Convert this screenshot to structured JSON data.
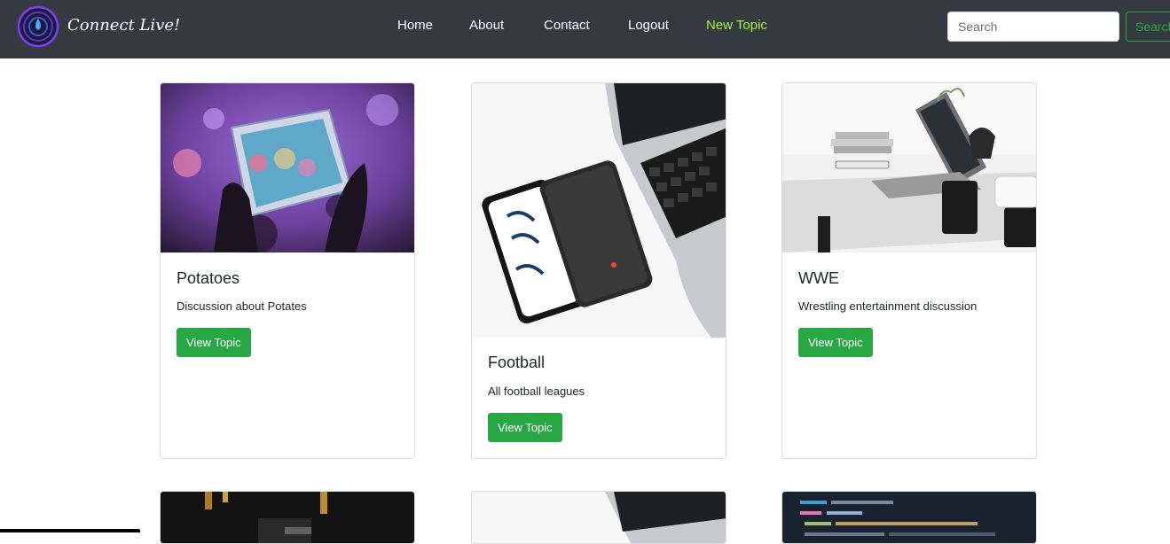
{
  "brand": {
    "name": "Connect Live!"
  },
  "nav": {
    "links": [
      {
        "label": "Home"
      },
      {
        "label": "About"
      },
      {
        "label": "Contact"
      },
      {
        "label": "Logout"
      },
      {
        "label": "New Topic"
      }
    ]
  },
  "search": {
    "placeholder": "Search",
    "button_label": "Search"
  },
  "topics": [
    {
      "title": "Potatoes",
      "description": "Discussion about Potates",
      "button_label": "View Topic"
    },
    {
      "title": "Football",
      "description": "All football leagues",
      "button_label": "View Topic"
    },
    {
      "title": "WWE",
      "description": "Wrestling entertainment discussion",
      "button_label": "View Topic"
    }
  ],
  "colors": {
    "navbar": "#343a40",
    "active_link": "#9ef542",
    "button": "#28a745"
  }
}
